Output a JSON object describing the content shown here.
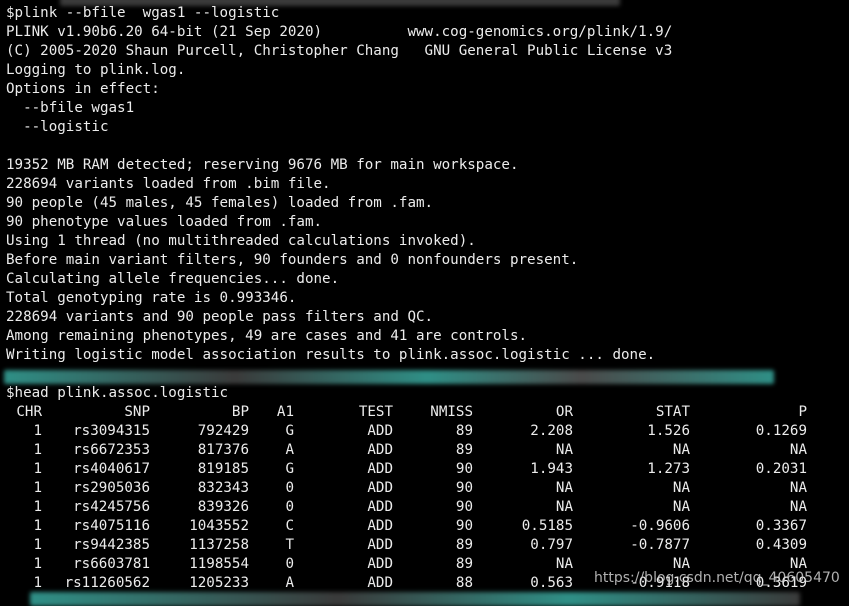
{
  "colors": {
    "background": "#000000",
    "text": "#ececec",
    "redacted": "#2f8f86"
  },
  "session": {
    "lines": [
      "$plink --bfile  wgas1 --logistic",
      "PLINK v1.90b6.20 64-bit (21 Sep 2020)          www.cog-genomics.org/plink/1.9/",
      "(C) 2005-2020 Shaun Purcell, Christopher Chang   GNU General Public License v3",
      "Logging to plink.log.",
      "Options in effect:",
      "  --bfile wgas1",
      "  --logistic",
      "",
      "19352 MB RAM detected; reserving 9676 MB for main workspace.",
      "228694 variants loaded from .bim file.",
      "90 people (45 males, 45 females) loaded from .fam.",
      "90 phenotype values loaded from .fam.",
      "Using 1 thread (no multithreaded calculations invoked).",
      "Before main variant filters, 90 founders and 0 nonfounders present.",
      "Calculating allele frequencies... done.",
      "Total genotyping rate is 0.993346.",
      "228694 variants and 90 people pass filters and QC.",
      "Among remaining phenotypes, 49 are cases and 41 are controls.",
      "Writing logistic model association results to plink.assoc.logistic ... done."
    ],
    "head_command": "$head plink.assoc.logistic"
  },
  "table": {
    "headers": [
      "CHR",
      "SNP",
      "BP",
      "A1",
      "TEST",
      "NMISS",
      "OR",
      "STAT",
      "P"
    ],
    "rows": [
      [
        "1",
        "rs3094315",
        "792429",
        "G",
        "ADD",
        "89",
        "2.208",
        "1.526",
        "0.1269"
      ],
      [
        "1",
        "rs6672353",
        "817376",
        "A",
        "ADD",
        "89",
        "NA",
        "NA",
        "NA"
      ],
      [
        "1",
        "rs4040617",
        "819185",
        "G",
        "ADD",
        "90",
        "1.943",
        "1.273",
        "0.2031"
      ],
      [
        "1",
        "rs2905036",
        "832343",
        "0",
        "ADD",
        "90",
        "NA",
        "NA",
        "NA"
      ],
      [
        "1",
        "rs4245756",
        "839326",
        "0",
        "ADD",
        "90",
        "NA",
        "NA",
        "NA"
      ],
      [
        "1",
        "rs4075116",
        "1043552",
        "C",
        "ADD",
        "90",
        "0.5185",
        "-0.9606",
        "0.3367"
      ],
      [
        "1",
        "rs9442385",
        "1137258",
        "T",
        "ADD",
        "89",
        "0.797",
        "-0.7877",
        "0.4309"
      ],
      [
        "1",
        "rs6603781",
        "1198554",
        "0",
        "ADD",
        "89",
        "NA",
        "NA",
        "NA"
      ],
      [
        "1",
        "rs11260562",
        "1205233",
        "A",
        "ADD",
        "88",
        "0.563",
        "-0.9118",
        "0.3619"
      ]
    ]
  },
  "watermark": "https://blog.csdn.net/qq_40605470"
}
